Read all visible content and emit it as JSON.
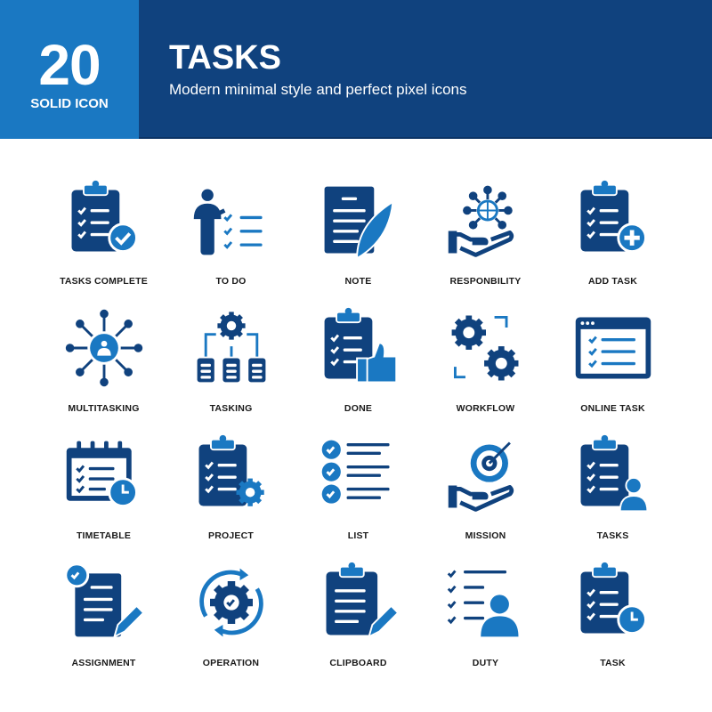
{
  "header": {
    "count": "20",
    "style": "SOLID ICON",
    "title": "TASKS",
    "subtitle": "Modern minimal style and perfect pixel icons"
  },
  "colors": {
    "navy": "#10427e",
    "blue": "#1a78c2",
    "text": "#1a1a1a"
  },
  "icons": [
    {
      "label": "TASKS COMPLETE",
      "icon": "clipboard-check-icon"
    },
    {
      "label": "TO DO",
      "icon": "person-checklist-icon"
    },
    {
      "label": "NOTE",
      "icon": "document-feather-icon"
    },
    {
      "label": "RESPONBILITY",
      "icon": "hand-globe-network-icon"
    },
    {
      "label": "ADD TASK",
      "icon": "clipboard-plus-icon"
    },
    {
      "label": "MULTITASKING",
      "icon": "person-network-icon"
    },
    {
      "label": "TASKING",
      "icon": "gear-hierarchy-icon"
    },
    {
      "label": "DONE",
      "icon": "clipboard-thumbs-up-icon"
    },
    {
      "label": "WORKFLOW",
      "icon": "gears-arrows-icon"
    },
    {
      "label": "ONLINE TASK",
      "icon": "browser-checklist-icon"
    },
    {
      "label": "TIMETABLE",
      "icon": "calendar-clock-icon"
    },
    {
      "label": "PROJECT",
      "icon": "clipboard-gear-icon"
    },
    {
      "label": "LIST",
      "icon": "checklist-icon"
    },
    {
      "label": "MISSION",
      "icon": "hand-target-icon"
    },
    {
      "label": "TASKS",
      "icon": "clipboard-person-icon"
    },
    {
      "label": "ASSIGNMENT",
      "icon": "document-pencil-check-icon"
    },
    {
      "label": "OPERATION",
      "icon": "gear-cycle-check-icon"
    },
    {
      "label": "CLIPBOARD",
      "icon": "clipboard-pencil-icon"
    },
    {
      "label": "DUTY",
      "icon": "checklist-person-icon"
    },
    {
      "label": "TASK",
      "icon": "clipboard-clock-icon"
    }
  ]
}
